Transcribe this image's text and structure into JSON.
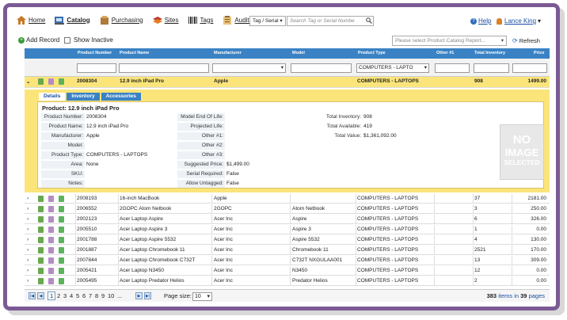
{
  "nav": {
    "items": [
      {
        "label": "Home",
        "icon": "home-icon"
      },
      {
        "label": "Catalog",
        "icon": "catalog-icon"
      },
      {
        "label": "Purchasing",
        "icon": "purchasing-icon"
      },
      {
        "label": "Sites",
        "icon": "sites-icon"
      },
      {
        "label": "Tags",
        "icon": "tags-icon"
      },
      {
        "label": "Audits",
        "icon": "audits-icon"
      }
    ],
    "search_type": "Tag / Serial",
    "search_placeholder": "Search Tag or Serial Numbe",
    "help": "Help",
    "user": "Lance King"
  },
  "toolbar": {
    "add_record": "Add Record",
    "show_inactive": "Show Inactive",
    "report_placeholder": "Please select Product Catalog Report...",
    "refresh": "Refresh"
  },
  "grid": {
    "columns": [
      "Product Number",
      "Product Name",
      "Manufacturer",
      "Model",
      "Product Type",
      "Other #1",
      "Total Inventory",
      "Price"
    ],
    "filter_product_type": "COMPUTERS - LAPTO",
    "selected_row": {
      "product_number": "2008304",
      "product_name": "12.9 inch iPad Pro",
      "manufacturer": "Apple",
      "model": "",
      "product_type": "COMPUTERS - LAPTOPS",
      "other1": "",
      "total_inventory": "908",
      "price": "1499.00"
    },
    "rows": [
      {
        "product_number": "2008193",
        "product_name": "16-inch MacBook",
        "manufacturer": "Apple",
        "model": "",
        "product_type": "COMPUTERS - LAPTOPS",
        "other1": "",
        "total_inventory": "37",
        "price": "2181.00"
      },
      {
        "product_number": "2006552",
        "product_name": "2GOPC Atom Netbook",
        "manufacturer": "2GOPC",
        "model": "Atom Netbook",
        "product_type": "COMPUTERS - LAPTOPS",
        "other1": "",
        "total_inventory": "3",
        "price": "250.00"
      },
      {
        "product_number": "2002123",
        "product_name": "Acer Laptop Aspire",
        "manufacturer": "Acer Inc",
        "model": "Aspire",
        "product_type": "COMPUTERS - LAPTOPS",
        "other1": "",
        "total_inventory": "6",
        "price": "326.00"
      },
      {
        "product_number": "2005510",
        "product_name": "Acer Laptop Aspire 3",
        "manufacturer": "Acer Inc",
        "model": "Aspire 3",
        "product_type": "COMPUTERS - LAPTOPS",
        "other1": "",
        "total_inventory": "1",
        "price": "0.00"
      },
      {
        "product_number": "2001788",
        "product_name": "Acer Laptop Aspire 5532",
        "manufacturer": "Acer Inc",
        "model": "Aspire 5532",
        "product_type": "COMPUTERS - LAPTOPS",
        "other1": "",
        "total_inventory": "4",
        "price": "130.00"
      },
      {
        "product_number": "2001887",
        "product_name": "Acer Laptop Chromebook 11",
        "manufacturer": "Acer Inc",
        "model": "Chromebook 11",
        "product_type": "COMPUTERS - LAPTOPS",
        "other1": "",
        "total_inventory": "2521",
        "price": "170.00"
      },
      {
        "product_number": "2007844",
        "product_name": "Acer Laptop Chromebook C732T",
        "manufacturer": "Acer Inc",
        "model": "C732T NXGULAA001",
        "product_type": "COMPUTERS - LAPTOPS",
        "other1": "",
        "total_inventory": "13",
        "price": "309.00"
      },
      {
        "product_number": "2005421",
        "product_name": "Acer Laptop N3450",
        "manufacturer": "Acer Inc",
        "model": "N3450",
        "product_type": "COMPUTERS - LAPTOPS",
        "other1": "",
        "total_inventory": "12",
        "price": "0.00"
      },
      {
        "product_number": "2005495",
        "product_name": "Acer Laptop Predator Helios",
        "manufacturer": "Acer Inc",
        "model": "Predator Helios",
        "product_type": "COMPUTERS - LAPTOPS",
        "other1": "",
        "total_inventory": "2",
        "price": "0.00"
      }
    ]
  },
  "detail": {
    "tabs": [
      "Details",
      "Inventory",
      "Accessories"
    ],
    "title": "Product: 12.9 inch iPad Pro",
    "left": [
      {
        "label": "Product Number:",
        "value": "2008304"
      },
      {
        "label": "Product Name:",
        "value": "12.9 inch iPad Pro"
      },
      {
        "label": "Manufacturer:",
        "value": "Apple"
      },
      {
        "label": "Model:",
        "value": ""
      },
      {
        "label": "Product Type:",
        "value": "COMPUTERS - LAPTOPS"
      },
      {
        "label": "Area:",
        "value": "None"
      },
      {
        "label": "SKU:",
        "value": ""
      },
      {
        "label": "Notes:",
        "value": ""
      }
    ],
    "middle": [
      {
        "label": "Model End Of Life:",
        "value": ""
      },
      {
        "label": "Projected Life:",
        "value": ""
      },
      {
        "label": "Other #1:",
        "value": ""
      },
      {
        "label": "Other #2:",
        "value": ""
      },
      {
        "label": "Other #3:",
        "value": ""
      },
      {
        "label": "Suggested Price:",
        "value": "$1,499.00"
      },
      {
        "label": "Serial Required:",
        "value": "False"
      },
      {
        "label": "Allow Untagged:",
        "value": "False"
      }
    ],
    "right": [
      {
        "label": "Total Inventory:",
        "value": "908"
      },
      {
        "label": "Total Available:",
        "value": "419"
      },
      {
        "label": "Total Value:",
        "value": "$1,361,092.00"
      }
    ],
    "no_image": [
      "NO",
      "IMAGE",
      "SELECTED"
    ]
  },
  "pager": {
    "first": "|◀",
    "prev": "◀",
    "next": "▶",
    "last": "▶|",
    "pages": [
      "1",
      "2",
      "3",
      "4",
      "5",
      "6",
      "7",
      "8",
      "9",
      "10",
      "..."
    ],
    "page_size_label": "Page size:",
    "page_size": "10",
    "items_count": "383",
    "items_text": "items in",
    "pages_count": "39",
    "pages_text": "pages"
  },
  "colors": {
    "accent": "#3a82c4",
    "selected_row": "#fbe57a",
    "frame": "#7b5a94"
  }
}
